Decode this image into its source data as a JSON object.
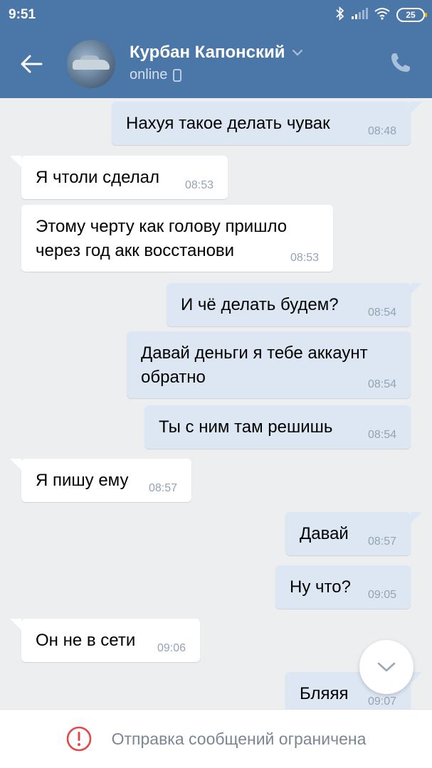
{
  "status_bar": {
    "time": "9:51",
    "battery": "25"
  },
  "header": {
    "contact_name": "Курбан Капонский",
    "status": "online"
  },
  "messages": [
    {
      "direction": "out",
      "text": "Нахуя такое делать чувак",
      "time": "08:48"
    },
    {
      "direction": "in",
      "text": "Я чтоли сделал",
      "time": "08:53"
    },
    {
      "direction": "in",
      "text_line1": "Этому черту как голову пришло",
      "text_line2": "через год акк восстанови",
      "time": "08:53"
    },
    {
      "direction": "out",
      "text": "И чё делать будем?",
      "time": "08:54"
    },
    {
      "direction": "out",
      "text_line1": "Давай деньги я тебе аккаунт",
      "text_line2": "обратно",
      "time": "08:54"
    },
    {
      "direction": "out",
      "text": "Ты с ним там решишь",
      "time": "08:54"
    },
    {
      "direction": "in",
      "text": "Я пишу ему",
      "time": "08:57"
    },
    {
      "direction": "out",
      "text": "Давай",
      "time": "08:57"
    },
    {
      "direction": "out",
      "text": "Ну что?",
      "time": "09:05"
    },
    {
      "direction": "in",
      "text": "Он не в сети",
      "time": "09:06"
    },
    {
      "direction": "out",
      "text": "Бляяя",
      "time": "09:07"
    }
  ],
  "footer": {
    "notice": "Отправка сообщений ограничена"
  },
  "colors": {
    "header_bg": "#4a76a8",
    "chat_bg": "#edeef0",
    "outgoing_bubble": "#dde7f3",
    "incoming_bubble": "#ffffff",
    "alert_red": "#e64646"
  },
  "icons": [
    "back-arrow-icon",
    "chevron-down-icon",
    "mobile-phone-icon",
    "phone-call-icon",
    "bluetooth-icon",
    "signal-icon",
    "wifi-icon",
    "battery-icon",
    "chevron-down-icon",
    "alert-circle-icon"
  ]
}
